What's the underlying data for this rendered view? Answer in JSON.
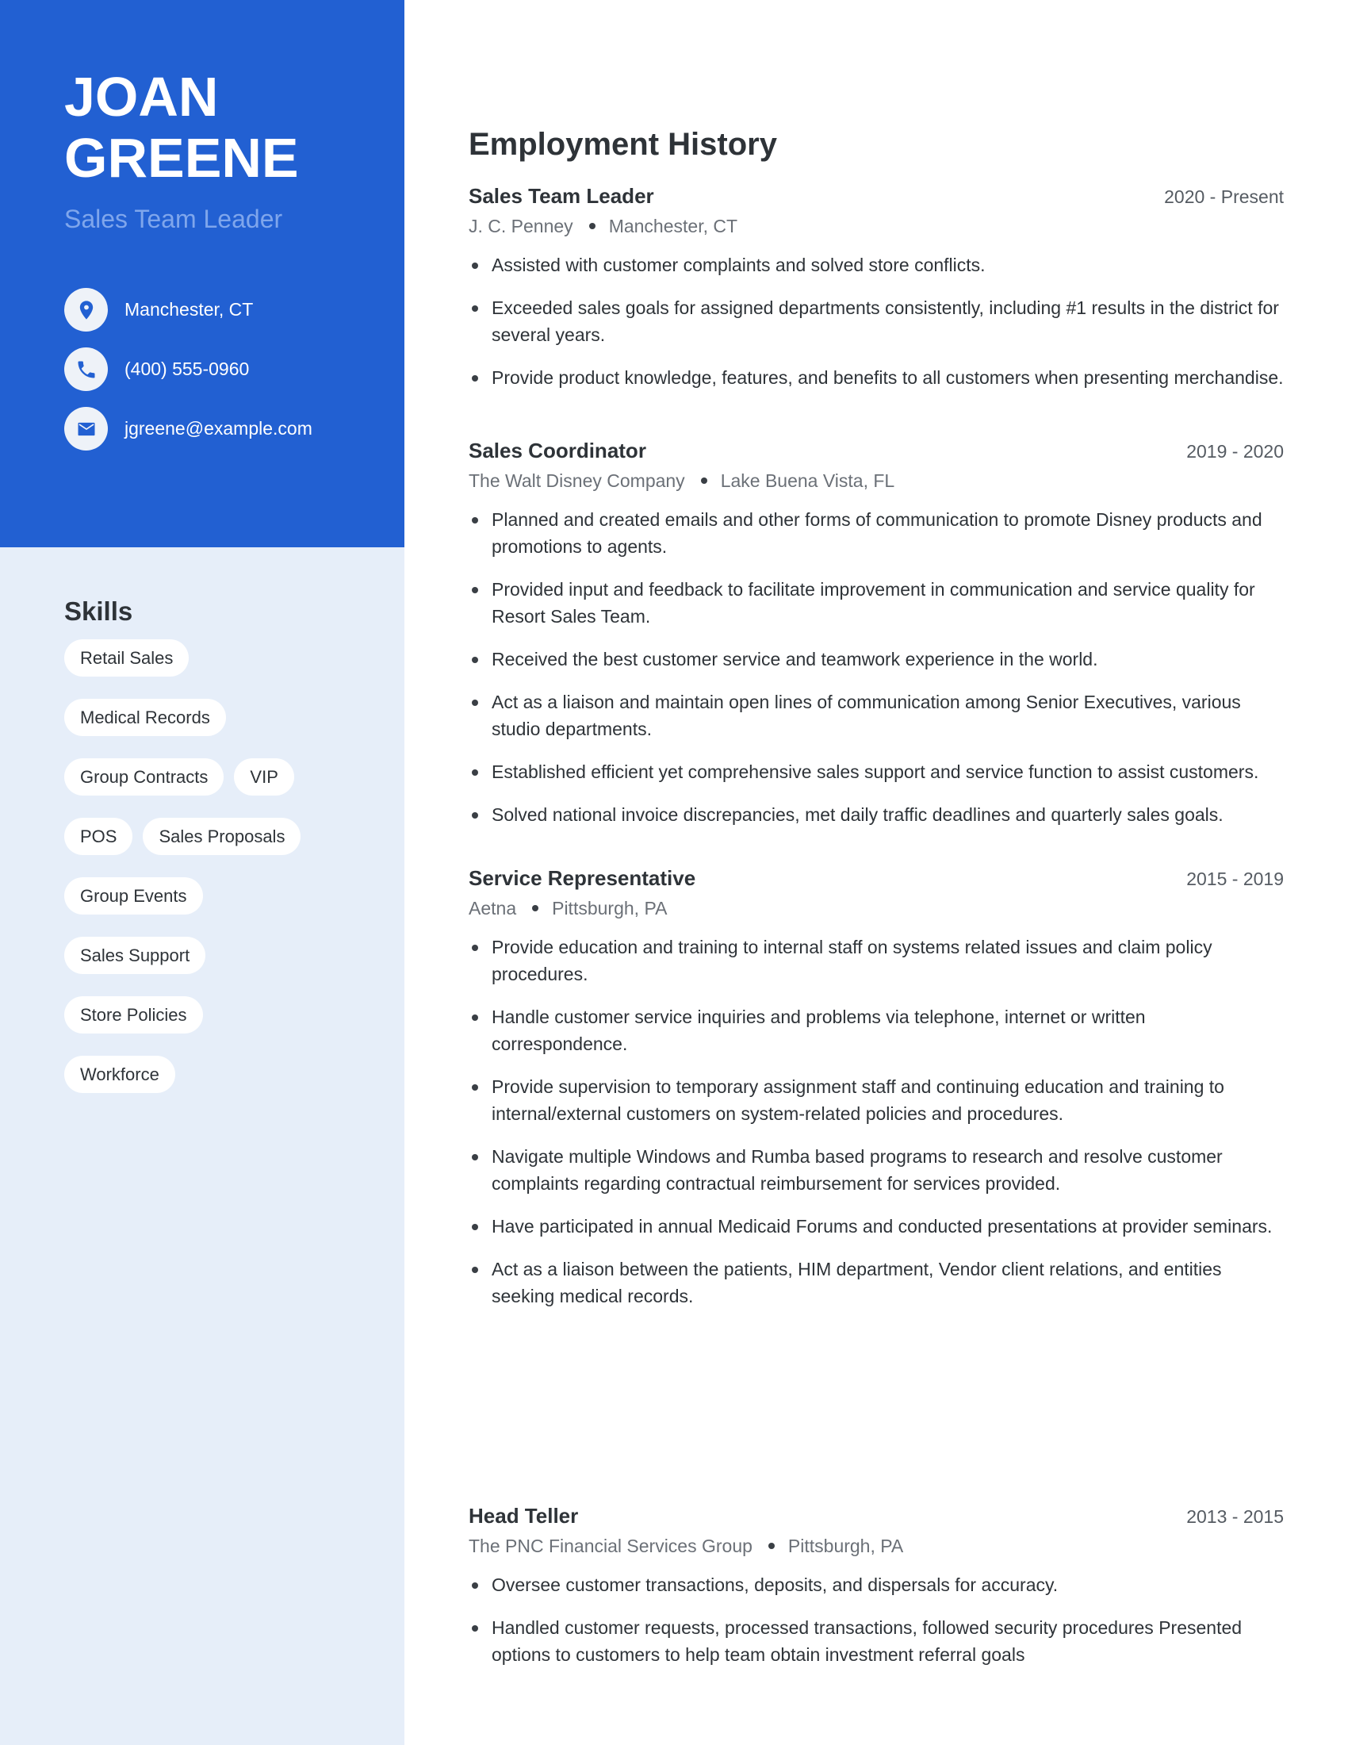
{
  "profile": {
    "first_name": "JOAN",
    "last_name": "GREENE",
    "title": "Sales Team Leader"
  },
  "contacts": [
    {
      "icon": "location-pin-icon",
      "text": "Manchester, CT"
    },
    {
      "icon": "phone-icon",
      "text": "(400) 555-0960"
    },
    {
      "icon": "envelope-icon",
      "text": "jgreene@example.com"
    }
  ],
  "skills": {
    "title": "Skills",
    "items": [
      "Retail Sales",
      "Medical Records",
      "Group Contracts",
      "VIP",
      "POS",
      "Sales Proposals",
      "Group Events",
      "Sales Support",
      "Store Policies",
      "Workforce"
    ]
  },
  "employment": {
    "title": "Employment History",
    "jobs": [
      {
        "title": "Sales Team Leader",
        "dates": "2020 - Present",
        "company": "J. C. Penney",
        "location": "Manchester, CT",
        "bullets": [
          "Assisted with customer complaints and solved store conflicts.",
          "Exceeded sales goals for assigned departments consistently, including #1 results in the district for several years.",
          "Provide product knowledge, features, and benefits to all customers when presenting merchandise."
        ]
      },
      {
        "title": "Sales Coordinator",
        "dates": "2019 - 2020",
        "company": "The Walt Disney Company",
        "location": "Lake Buena Vista, FL",
        "bullets": [
          "Planned and created emails and other forms of communication to promote Disney products and promotions to agents.",
          "Provided input and feedback to facilitate improvement in communication and service quality for Resort Sales Team.",
          "Received the best customer service and teamwork experience in the world.",
          "Act as a liaison and maintain open lines of communication among Senior Executives, various studio departments.",
          "Established efficient yet comprehensive sales support and service function to assist customers.",
          "Solved national invoice discrepancies, met daily traffic deadlines and quarterly sales goals."
        ]
      },
      {
        "title": "Service Representative",
        "dates": "2015 - 2019",
        "company": "Aetna",
        "location": "Pittsburgh, PA",
        "bullets": [
          "Provide education and training to internal staff on systems related issues and claim policy procedures.",
          "Handle customer service inquiries and problems via telephone, internet or written correspondence.",
          "Provide supervision to temporary assignment staff and continuing education and training to internal/external customers on system-related policies and procedures.",
          "Navigate multiple Windows and Rumba based programs to research and resolve customer complaints regarding contractual reimbursement for services provided.",
          "Have participated in annual Medicaid Forums and conducted presentations at provider seminars.",
          "Act as a liaison between the patients, HIM department, Vendor client relations, and entities seeking medical records."
        ]
      },
      {
        "title": "Head Teller",
        "dates": "2013 - 2015",
        "company": "The PNC Financial Services Group",
        "location": "Pittsburgh, PA",
        "bullets": [
          "Oversee customer transactions, deposits, and dispersals for accuracy.",
          "Handled customer requests, processed transactions, followed security procedures Presented options to customers to help team obtain investment referral goals"
        ]
      }
    ]
  },
  "colors": {
    "accent": "#2260d2",
    "sidebar_light": "#e6eef9",
    "role_text": "#7fa6ec"
  }
}
